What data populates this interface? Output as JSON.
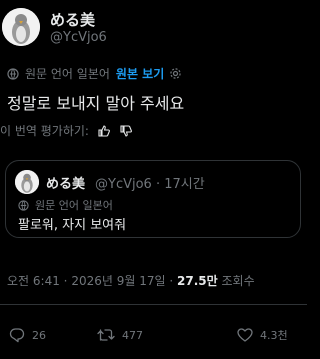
{
  "author": {
    "name": "める美",
    "handle": "@YcVjo6"
  },
  "translation": {
    "label": "원문 언어 일본어",
    "show_original": "원본 보기"
  },
  "tweet": {
    "text": "정말로 보내지 말아 주세요",
    "rate_label": "이 번역 평가하기:"
  },
  "quote": {
    "name": "める美",
    "handle": "@YcVjo6",
    "separator": "·",
    "time": "17시간",
    "translation_label": "원문 언어 일본어",
    "text": "팔로워, 자지 보여줘"
  },
  "meta": {
    "time": "오전 6:41",
    "separator": "·",
    "date": "2026년 9월 17일",
    "views_count": "27.5만",
    "views_label": "조회수"
  },
  "actions": {
    "replies": "26",
    "reposts": "477",
    "likes": "4.3천"
  },
  "colors": {
    "background": "#000000",
    "text": "#e7e9ea",
    "muted": "#71767b",
    "link": "#1d9bf0",
    "border": "#2f3336"
  }
}
